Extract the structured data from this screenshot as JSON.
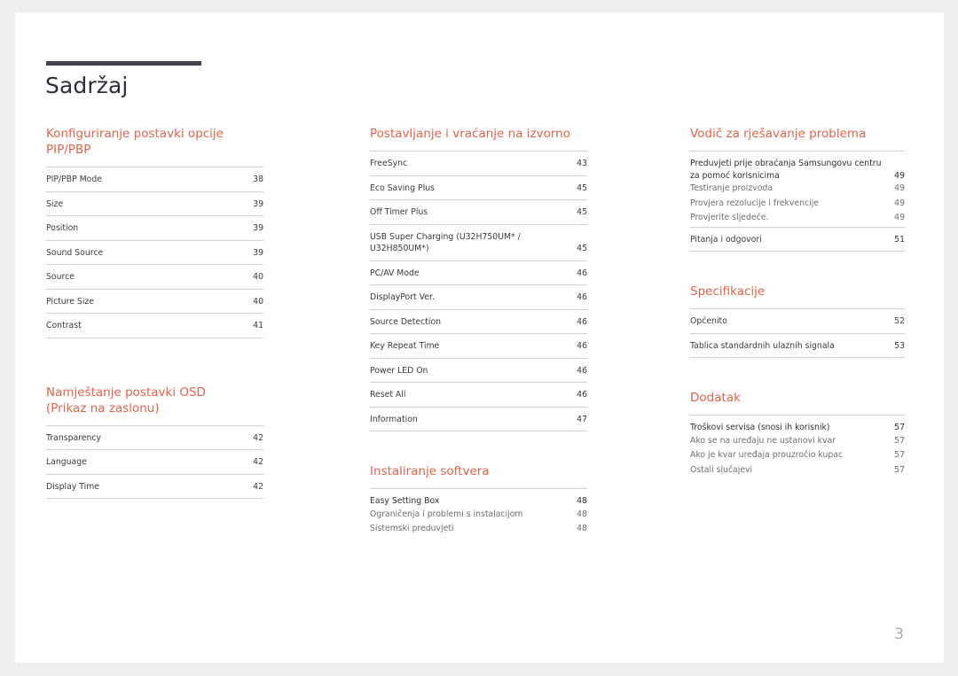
{
  "document": {
    "title": "Sadržaj",
    "page_number": "3",
    "accent_color": "#e2634b",
    "rule_color": "#434250"
  },
  "columns": [
    {
      "name": "column-1",
      "sections": [
        {
          "heading": "Konfiguriranje postavki opcije PIP/PBP",
          "entries": [
            {
              "label": "PIP/PBP Mode",
              "page": "38",
              "level": "main"
            },
            {
              "label": "Size",
              "page": "39",
              "level": "main"
            },
            {
              "label": "Position",
              "page": "39",
              "level": "main"
            },
            {
              "label": "Sound Source",
              "page": "39",
              "level": "main"
            },
            {
              "label": "Source",
              "page": "40",
              "level": "main"
            },
            {
              "label": "Picture Size",
              "page": "40",
              "level": "main"
            },
            {
              "label": "Contrast",
              "page": "41",
              "level": "main"
            }
          ]
        },
        {
          "heading": "Namještanje postavki OSD\n(Prikaz na zaslonu)",
          "entries": [
            {
              "label": "Transparency",
              "page": "42",
              "level": "main"
            },
            {
              "label": "Language",
              "page": "42",
              "level": "main"
            },
            {
              "label": "Display Time",
              "page": "42",
              "level": "main"
            }
          ]
        }
      ]
    },
    {
      "name": "column-2",
      "sections": [
        {
          "heading": "Postavljanje i vraćanje na izvorno",
          "entries": [
            {
              "label": "FreeSync",
              "page": "43",
              "level": "main"
            },
            {
              "label": "Eco Saving Plus",
              "page": "45",
              "level": "main"
            },
            {
              "label": "Off Timer Plus",
              "page": "45",
              "level": "main"
            },
            {
              "label": "USB Super Charging (U32H750UM* / U32H850UM*)",
              "page": "45",
              "level": "main"
            },
            {
              "label": "PC/AV Mode",
              "page": "46",
              "level": "main"
            },
            {
              "label": "DisplayPort Ver.",
              "page": "46",
              "level": "main"
            },
            {
              "label": "Source Detection",
              "page": "46",
              "level": "main"
            },
            {
              "label": "Key Repeat Time",
              "page": "46",
              "level": "main"
            },
            {
              "label": "Power LED On",
              "page": "46",
              "level": "main"
            },
            {
              "label": "Reset All",
              "page": "46",
              "level": "main"
            },
            {
              "label": "Information",
              "page": "47",
              "level": "main"
            }
          ]
        },
        {
          "heading": "Instaliranje softvera",
          "entries": [
            {
              "label": "Easy Setting Box",
              "page": "48",
              "level": "group-head"
            },
            {
              "label": "Ograničenja i problemi s instalacijom",
              "page": "48",
              "level": "sub"
            },
            {
              "label": "Sistemski preduvjeti",
              "page": "48",
              "level": "sub"
            }
          ]
        }
      ]
    },
    {
      "name": "column-3",
      "sections": [
        {
          "heading": "Vodič za rješavanje problema",
          "entries": [
            {
              "label": "Preduvjeti prije obraćanja Samsungovu centru za pomoć korisnicima",
              "page": "49",
              "level": "group-head"
            },
            {
              "label": "Testiranje proizvoda",
              "page": "49",
              "level": "sub"
            },
            {
              "label": "Provjera rezolucije i frekvencije",
              "page": "49",
              "level": "sub"
            },
            {
              "label": "Provjerite sljedeće.",
              "page": "49",
              "level": "sub"
            },
            {
              "label": "Pitanja i odgovori",
              "page": "51",
              "level": "main"
            }
          ]
        },
        {
          "heading": "Specifikacije",
          "entries": [
            {
              "label": "Općenito",
              "page": "52",
              "level": "main"
            },
            {
              "label": "Tablica standardnih ulaznih signala",
              "page": "53",
              "level": "main"
            }
          ]
        },
        {
          "heading": "Dodatak",
          "entries": [
            {
              "label": "Troškovi servisa (snosi ih korisnik)",
              "page": "57",
              "level": "group-head"
            },
            {
              "label": "Ako se na uređaju ne ustanovi kvar",
              "page": "57",
              "level": "sub"
            },
            {
              "label": "Ako je kvar uređaja prouzročio kupac",
              "page": "57",
              "level": "sub"
            },
            {
              "label": "Ostali slučajevi",
              "page": "57",
              "level": "sub"
            }
          ]
        }
      ]
    }
  ]
}
